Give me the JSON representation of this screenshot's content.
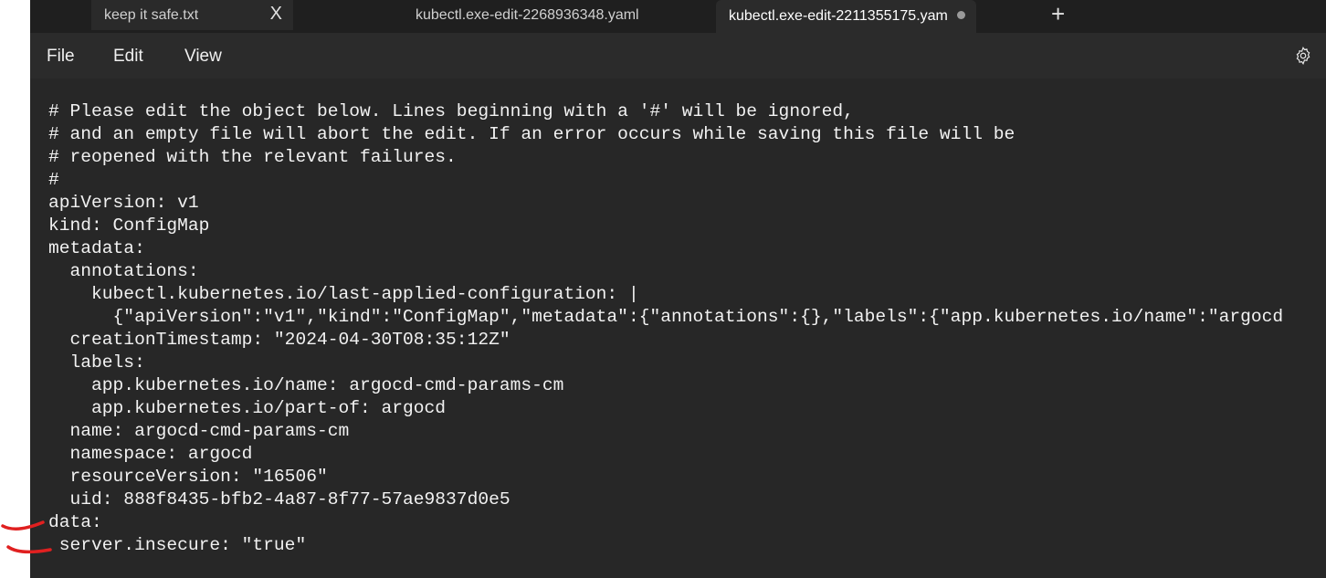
{
  "tabs": [
    {
      "label": "keep it safe.txt",
      "close": "X"
    },
    {
      "label": "kubectl.exe-edit-2268936348.yaml"
    },
    {
      "label": "kubectl.exe-edit-2211355175.yam",
      "modified": true
    }
  ],
  "new_tab": "+",
  "menu": {
    "file": "File",
    "edit": "Edit",
    "view": "View"
  },
  "lines": [
    "# Please edit the object below. Lines beginning with a '#' will be ignored,",
    "# and an empty file will abort the edit. If an error occurs while saving this file will be",
    "# reopened with the relevant failures.",
    "#",
    "apiVersion: v1",
    "kind: ConfigMap",
    "metadata:",
    "  annotations:",
    "    kubectl.kubernetes.io/last-applied-configuration: |",
    "      {\"apiVersion\":\"v1\",\"kind\":\"ConfigMap\",\"metadata\":{\"annotations\":{},\"labels\":{\"app.kubernetes.io/name\":\"argocd",
    "  creationTimestamp: \"2024-04-30T08:35:12Z\"",
    "  labels:",
    "    app.kubernetes.io/name: argocd-cmd-params-cm",
    "    app.kubernetes.io/part-of: argocd",
    "  name: argocd-cmd-params-cm",
    "  namespace: argocd",
    "  resourceVersion: \"16506\"",
    "  uid: 888f8435-bfb2-4a87-8f77-57ae9837d0e5",
    "data:",
    " server.insecure: \"true\""
  ]
}
